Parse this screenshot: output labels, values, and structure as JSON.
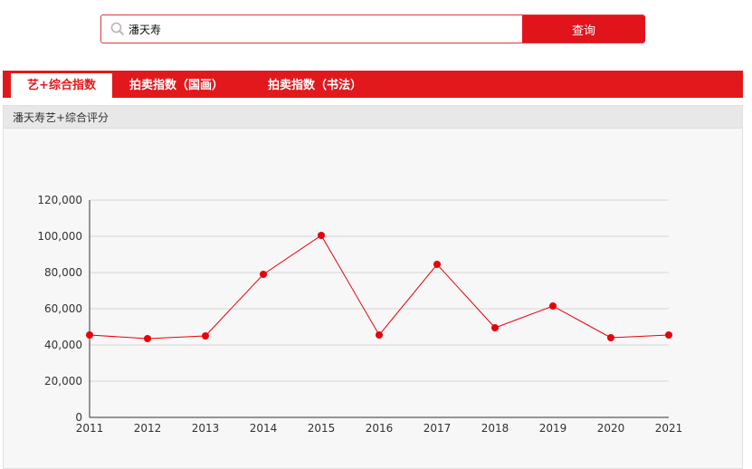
{
  "search": {
    "value": "潘天寿",
    "button_label": "查询"
  },
  "tabs": [
    {
      "label": "艺+综合指数",
      "active": true
    },
    {
      "label": "拍卖指数（国画）",
      "active": false
    },
    {
      "label": "拍卖指数（书法）",
      "active": false
    }
  ],
  "panel": {
    "title": "潘天寿艺+综合评分"
  },
  "colors": {
    "brand_red": "#e1191d",
    "series_red": "#e8000b"
  },
  "chart_data": {
    "type": "line",
    "x": [
      "2011",
      "2012",
      "2013",
      "2014",
      "2015",
      "2016",
      "2017",
      "2018",
      "2019",
      "2020",
      "2021"
    ],
    "values": [
      45500,
      43500,
      45000,
      79000,
      100500,
      45500,
      84500,
      49500,
      61500,
      44000,
      45500
    ],
    "y_ticks": [
      "0",
      "20,000",
      "40,000",
      "60,000",
      "80,000",
      "100,000",
      "120,000"
    ],
    "ylim": [
      0,
      120000
    ],
    "grid": "horizontal",
    "legend": "none",
    "title": "",
    "xlabel": "",
    "ylabel": ""
  }
}
